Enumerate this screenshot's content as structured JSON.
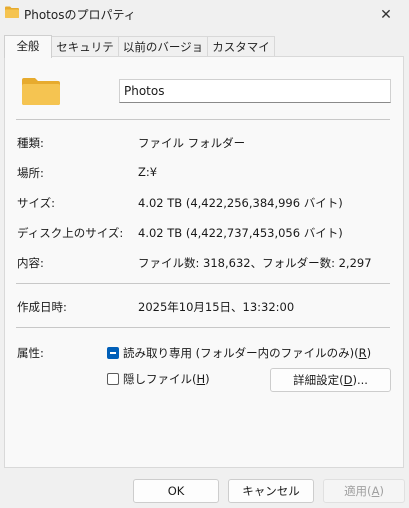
{
  "window": {
    "title": "Photosのプロパティ",
    "close_glyph": "✕"
  },
  "tabs": [
    {
      "label": "全般",
      "active": true
    },
    {
      "label": "セキュリティ",
      "active": false
    },
    {
      "label": "以前のバージョン",
      "active": false
    },
    {
      "label": "カスタマイズ",
      "active": false
    }
  ],
  "general": {
    "folder_name": "Photos",
    "rows": {
      "type": {
        "label": "種類:",
        "value": "ファイル フォルダー"
      },
      "location": {
        "label": "場所:",
        "value": "Z:¥"
      },
      "size": {
        "label": "サイズ:",
        "value": "4.02 TB (4,422,256,384,996 バイト)"
      },
      "disk_size": {
        "label": "ディスク上のサイズ:",
        "value": "4.02 TB (4,422,737,453,056 バイト)"
      },
      "contents": {
        "label": "内容:",
        "value": "ファイル数: 318,632、フォルダー数: 2,297"
      },
      "created": {
        "label": "作成日時:",
        "value": "2025年10月15日、13:32:00"
      }
    },
    "attributes": {
      "label": "属性:",
      "readonly": {
        "text": "読み取り専用 (フォルダー内のファイルのみ)(",
        "key": "R",
        "suffix": ")",
        "state": "indeterminate"
      },
      "hidden": {
        "text": "隠しファイル(",
        "key": "H",
        "suffix": ")",
        "checked": false
      },
      "advanced": {
        "text": "詳細設定(",
        "key": "D",
        "suffix": ")..."
      }
    }
  },
  "footer": {
    "ok": "OK",
    "cancel": "キャンセル",
    "apply": {
      "text": "適用(",
      "key": "A",
      "suffix": ")"
    }
  },
  "colors": {
    "accent": "#005fb8",
    "folder": "#f5c451",
    "folder_back": "#e7ab2e"
  }
}
